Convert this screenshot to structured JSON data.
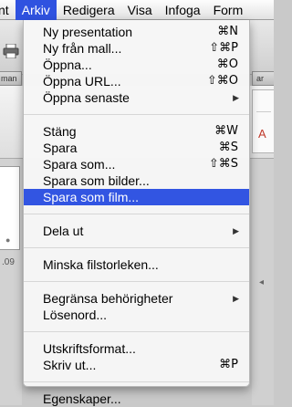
{
  "menubar": {
    "items": [
      {
        "label": "nt",
        "active": false
      },
      {
        "label": "Arkiv",
        "active": true
      },
      {
        "label": "Redigera",
        "active": false
      },
      {
        "label": "Visa",
        "active": false
      },
      {
        "label": "Infoga",
        "active": false
      },
      {
        "label": "Form",
        "active": false
      }
    ]
  },
  "background": {
    "tab_left": "man",
    "tab_right": "ar",
    "slide_number": ".09",
    "ribbon_right_glyph": "A"
  },
  "file_menu": {
    "groups": [
      [
        {
          "label": "Ny presentation",
          "shortcut": "⌘N"
        },
        {
          "label": "Ny från mall...",
          "shortcut": "⇧⌘P"
        },
        {
          "label": "Öppna...",
          "shortcut": "⌘O"
        },
        {
          "label": "Öppna URL...",
          "shortcut": "⇧⌘O"
        },
        {
          "label": "Öppna senaste",
          "submenu": true
        }
      ],
      [
        {
          "label": "Stäng",
          "shortcut": "⌘W"
        },
        {
          "label": "Spara",
          "shortcut": "⌘S"
        },
        {
          "label": "Spara som...",
          "shortcut": "⇧⌘S"
        },
        {
          "label": "Spara som bilder..."
        },
        {
          "label": "Spara som film...",
          "highlighted": true
        }
      ],
      [
        {
          "label": "Dela ut",
          "submenu": true
        }
      ],
      [
        {
          "label": "Minska filstorleken..."
        }
      ],
      [
        {
          "label": "Begränsa behörigheter",
          "submenu": true
        },
        {
          "label": "Lösenord..."
        }
      ],
      [
        {
          "label": "Utskriftsformat..."
        },
        {
          "label": "Skriv ut...",
          "shortcut": "⌘P"
        }
      ],
      [
        {
          "label": "Egenskaper..."
        }
      ]
    ]
  },
  "colors": {
    "highlight": "#3255e2",
    "menu_background": "#f6f6f6"
  }
}
